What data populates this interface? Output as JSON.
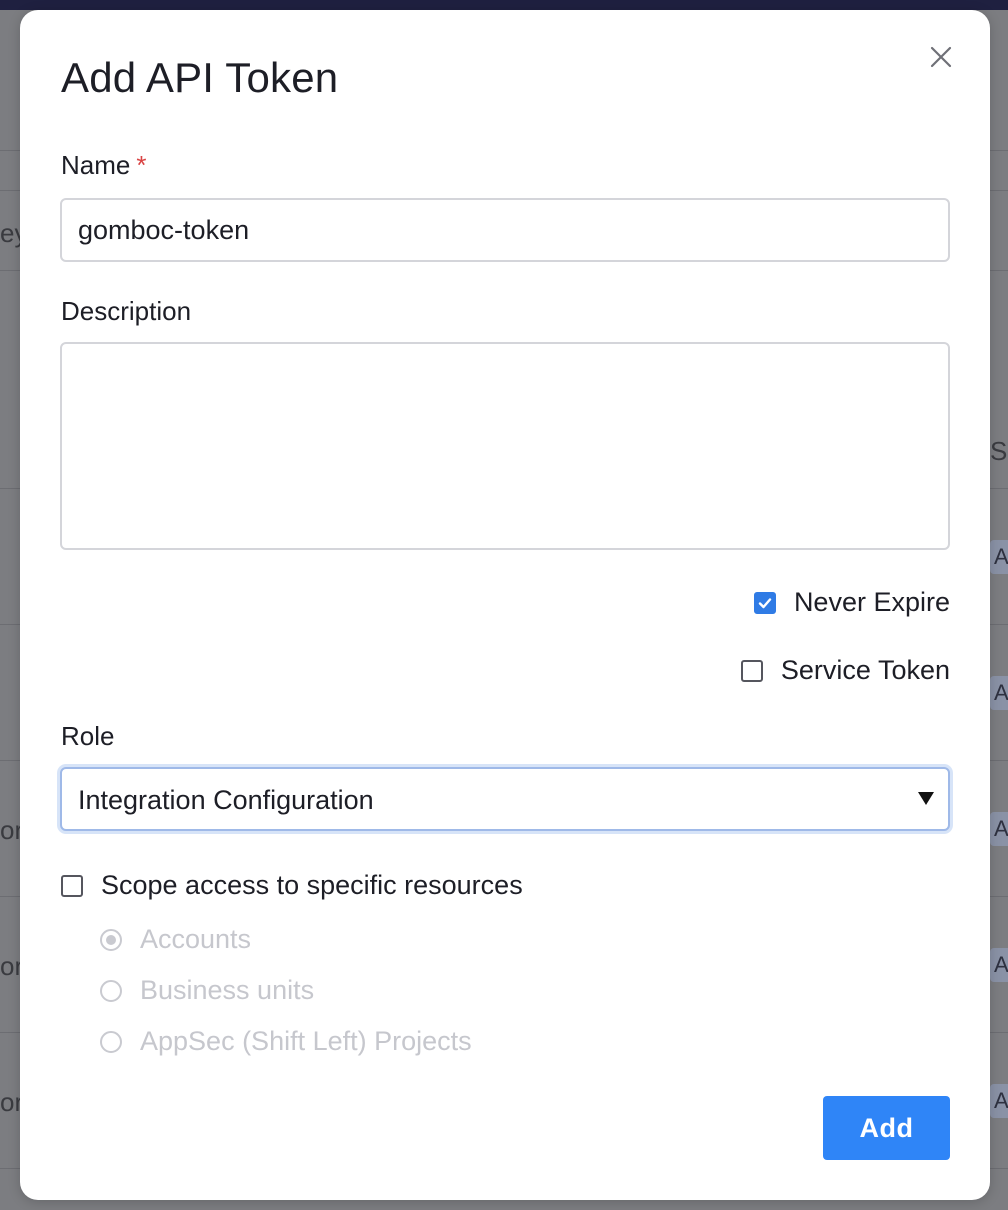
{
  "background": {
    "fragments_left": [
      "ey",
      "or",
      "or",
      "or"
    ],
    "fragment_right_top": "Sc",
    "chips_right": [
      "A",
      "A",
      "A",
      "A",
      "A"
    ]
  },
  "modal": {
    "title": "Add API Token",
    "close_icon": "close-icon",
    "name": {
      "label": "Name",
      "required_mark": "*",
      "value": "gomboc-token"
    },
    "description": {
      "label": "Description",
      "value": ""
    },
    "never_expire": {
      "label": "Never Expire",
      "checked": true
    },
    "service_token": {
      "label": "Service Token",
      "checked": false
    },
    "role": {
      "label": "Role",
      "selected": "Integration Configuration",
      "icon": "caret-down-icon"
    },
    "scope": {
      "label": "Scope access to specific resources",
      "checked": false,
      "options": [
        {
          "label": "Accounts",
          "selected": true
        },
        {
          "label": "Business units",
          "selected": false
        },
        {
          "label": "AppSec (Shift Left) Projects",
          "selected": false
        }
      ]
    },
    "add_label": "Add"
  },
  "colors": {
    "accent": "#2f85f7",
    "checkbox_checked": "#2f7be5",
    "required": "#d94343",
    "disabled_text": "#c6c7cd"
  }
}
